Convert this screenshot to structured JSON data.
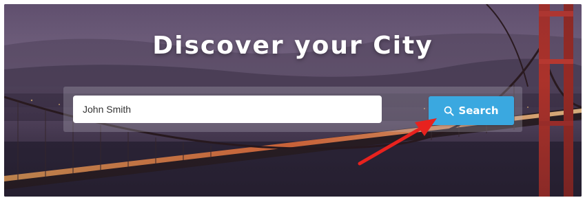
{
  "hero": {
    "title": "Discover your City"
  },
  "search": {
    "value": "John Smith",
    "button_label": "Search",
    "button_color": "#3aa8e0"
  },
  "annotation": {
    "arrow_color": "#e8221e"
  },
  "icons": {
    "search_button_icon": "search-icon"
  }
}
